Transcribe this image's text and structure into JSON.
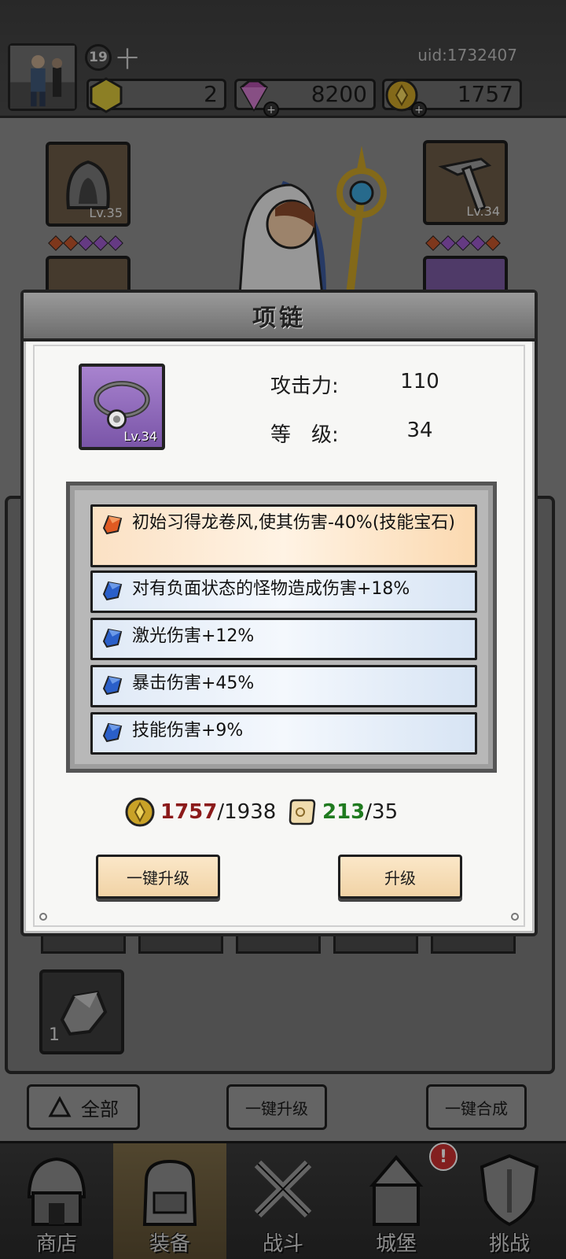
{
  "player": {
    "level": "19",
    "uid": "uid:1732407"
  },
  "resources": {
    "gold": "2",
    "gems": "8200",
    "coins": "1757"
  },
  "equipment": {
    "slot_left_level": "Lv.35",
    "slot_right_level": "Lv.34"
  },
  "inventory": {
    "item_count": "1"
  },
  "bottom_buttons": {
    "filter_label": "全部",
    "upgrade_all_label": "一键升级",
    "merge_all_label": "一键合成"
  },
  "tabs": [
    {
      "label": "商店"
    },
    {
      "label": "装备"
    },
    {
      "label": "战斗"
    },
    {
      "label": "城堡"
    },
    {
      "label": "挑战"
    }
  ],
  "notification_badge": "!",
  "modal": {
    "title": "项链",
    "item_level": "Lv.34",
    "attack_label": "攻击力:",
    "attack_value": "110",
    "level_label": "等　级:",
    "level_value": "34",
    "affixes": [
      {
        "text": "初始习得龙卷风,使其伤害-40%(技能宝石)",
        "color": "orange"
      },
      {
        "text": "对有负面状态的怪物造成伤害+18%",
        "color": "blue"
      },
      {
        "text": "激光伤害+12%",
        "color": "blue"
      },
      {
        "text": "暴击伤害+45%",
        "color": "blue"
      },
      {
        "text": "技能伤害+9%",
        "color": "blue"
      }
    ],
    "coin_cost": {
      "have": "1757",
      "need": "/1938"
    },
    "scroll_cost": {
      "have": "213",
      "need": "/35"
    },
    "upgrade_all_button": "一键升级",
    "upgrade_button": "升级"
  },
  "colors": {
    "affix_orange": "#fbe1c4",
    "affix_blue": "#dfe9f6",
    "insufficient": "#8b1a1a",
    "sufficient": "#1f7a1f",
    "item_rarity_purple": "#9a73c4"
  }
}
